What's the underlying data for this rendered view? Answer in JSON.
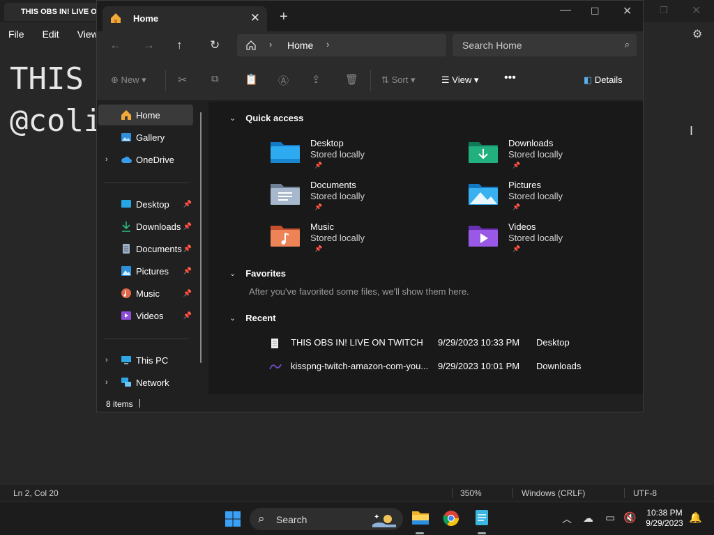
{
  "notepad": {
    "tab_title": "THIS OBS IN! LIVE ON TWITCH",
    "menu": [
      "File",
      "Edit",
      "View"
    ],
    "text_lines": [
      "THIS OBS IN! LIVE ON TWITCH",
      "@colinthe"
    ],
    "status": {
      "position": "Ln 2, Col 20",
      "zoom": "350%",
      "line_ending": "Windows (CRLF)",
      "encoding": "UTF-8"
    }
  },
  "explorer": {
    "tab_title": "Home",
    "address": {
      "crumb": "Home"
    },
    "search": {
      "placeholder": "Search Home"
    },
    "toolbar": {
      "new": "New",
      "sort": "Sort",
      "view": "View",
      "details": "Details"
    },
    "sidebar": {
      "top": [
        {
          "label": "Home",
          "icon": "home-icon"
        },
        {
          "label": "Gallery",
          "icon": "gallery-icon"
        },
        {
          "label": "OneDrive",
          "icon": "cloud-icon"
        }
      ],
      "pinned": [
        {
          "label": "Desktop",
          "icon": "desktop-icon"
        },
        {
          "label": "Downloads",
          "icon": "download-icon"
        },
        {
          "label": "Documents",
          "icon": "document-icon"
        },
        {
          "label": "Pictures",
          "icon": "pictures-icon"
        },
        {
          "label": "Music",
          "icon": "music-icon"
        },
        {
          "label": "Videos",
          "icon": "video-icon"
        }
      ],
      "bottom": [
        {
          "label": "This PC",
          "icon": "pc-icon"
        },
        {
          "label": "Network",
          "icon": "network-icon"
        }
      ]
    },
    "quick_access": {
      "title": "Quick access",
      "items": [
        {
          "name": "Desktop",
          "sub": "Stored locally",
          "color": "#1e9fe0"
        },
        {
          "name": "Downloads",
          "sub": "Stored locally",
          "color": "#1fa87a"
        },
        {
          "name": "Documents",
          "sub": "Stored locally",
          "color": "#8aa0b8"
        },
        {
          "name": "Pictures",
          "sub": "Stored locally",
          "color": "#2fa6e6"
        },
        {
          "name": "Music",
          "sub": "Stored locally",
          "color": "#e2724a"
        },
        {
          "name": "Videos",
          "sub": "Stored locally",
          "color": "#8e4ed8"
        }
      ]
    },
    "favorites": {
      "title": "Favorites",
      "empty_text": "After you've favorited some files, we'll show them here."
    },
    "recent": {
      "title": "Recent",
      "items": [
        {
          "name": "THIS OBS IN! LIVE ON TWITCH",
          "date": "9/29/2023 10:33 PM",
          "location": "Desktop"
        },
        {
          "name": "kisspng-twitch-amazon-com-you...",
          "date": "9/29/2023 10:01 PM",
          "location": "Downloads"
        }
      ]
    },
    "status": {
      "count": "8 items"
    }
  },
  "taskbar": {
    "search_label": "Search",
    "time": "10:38 PM",
    "date": "9/29/2023"
  }
}
